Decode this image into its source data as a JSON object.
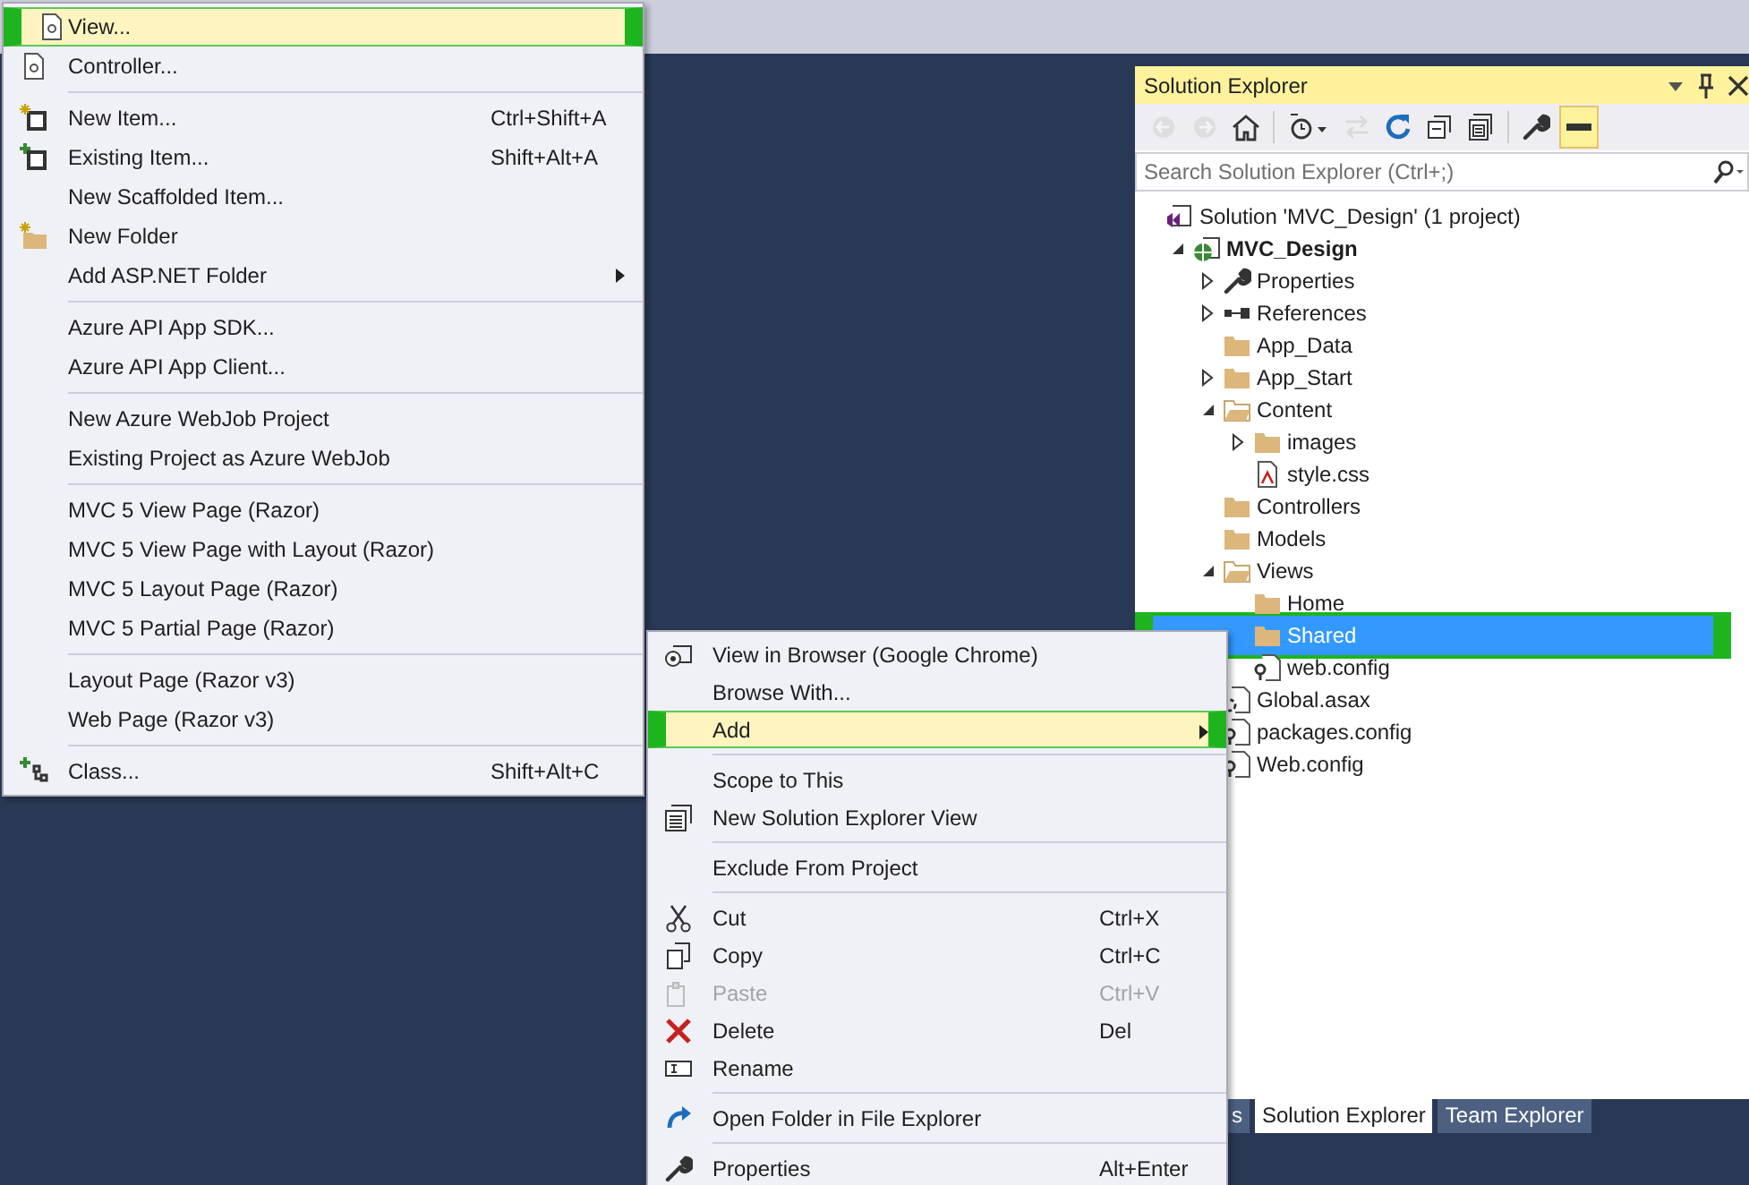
{
  "add_menu": {
    "groups": [
      {
        "items": [
          {
            "label": "View...",
            "kind": "page",
            "selected": true
          },
          {
            "label": "Controller...",
            "kind": "page",
            "selected": false
          }
        ]
      },
      {
        "items": [
          {
            "label": "New Item...",
            "kind": "new-item",
            "shortcut": "Ctrl+Shift+A",
            "selected": false
          },
          {
            "label": "Existing Item...",
            "kind": "existing-item",
            "shortcut": "Shift+Alt+A",
            "selected": false
          },
          {
            "label": "New Scaffolded Item...",
            "kind": "plain",
            "selected": false
          },
          {
            "label": "New Folder",
            "kind": "new-folder",
            "selected": false
          },
          {
            "label": "Add ASP.NET Folder",
            "kind": "plain",
            "submenu": true,
            "selected": false
          }
        ]
      },
      {
        "items": [
          {
            "label": "Azure API App SDK...",
            "kind": "plain",
            "selected": false
          },
          {
            "label": "Azure API App Client...",
            "kind": "plain",
            "selected": false
          }
        ]
      },
      {
        "items": [
          {
            "label": "New Azure WebJob Project",
            "kind": "plain",
            "selected": false
          },
          {
            "label": "Existing Project as Azure WebJob",
            "kind": "plain",
            "selected": false
          }
        ]
      },
      {
        "items": [
          {
            "label": "MVC 5 View Page (Razor)",
            "kind": "plain",
            "selected": false
          },
          {
            "label": "MVC 5 View Page with Layout (Razor)",
            "kind": "plain",
            "selected": false
          },
          {
            "label": "MVC 5 Layout Page (Razor)",
            "kind": "plain",
            "selected": false
          },
          {
            "label": "MVC 5 Partial Page (Razor)",
            "kind": "plain",
            "selected": false
          }
        ]
      },
      {
        "items": [
          {
            "label": "Layout Page (Razor v3)",
            "kind": "plain",
            "selected": false
          },
          {
            "label": "Web Page (Razor v3)",
            "kind": "plain",
            "selected": false
          }
        ]
      },
      {
        "items": [
          {
            "label": "Class...",
            "kind": "class",
            "shortcut": "Shift+Alt+C",
            "selected": false
          }
        ]
      }
    ]
  },
  "solution_explorer": {
    "title": "Solution Explorer",
    "toolbar": [
      {
        "kind": "back",
        "disabled": true,
        "on": false
      },
      {
        "kind": "forward",
        "disabled": true,
        "on": false
      },
      {
        "kind": "home",
        "disabled": false,
        "on": false
      },
      {
        "kind": "history",
        "disabled": false,
        "on": false
      },
      {
        "kind": "sync",
        "disabled": true,
        "on": false
      },
      {
        "kind": "refresh",
        "disabled": false,
        "on": false
      },
      {
        "kind": "collapse",
        "disabled": false,
        "on": false
      },
      {
        "kind": "show-files",
        "disabled": false,
        "on": false
      },
      {
        "kind": "properties",
        "disabled": false,
        "on": false
      },
      {
        "kind": "preview",
        "disabled": false,
        "on": true
      }
    ],
    "search": {
      "placeholder": "Search Solution Explorer (Ctrl+;)"
    },
    "tree": [
      {
        "label": "Solution 'MVC_Design' (1 project)",
        "kind": "solution",
        "selected": false,
        "children": [
          {
            "label": "MVC_Design",
            "kind": "project",
            "expanded": true,
            "selected": false,
            "children": [
              {
                "label": "Properties",
                "kind": "properties",
                "expanded": false,
                "selected": false
              },
              {
                "label": "References",
                "kind": "references",
                "expanded": false,
                "selected": false
              },
              {
                "label": "App_Data",
                "kind": "folder",
                "selected": false
              },
              {
                "label": "App_Start",
                "kind": "folder",
                "expanded": false,
                "selected": false
              },
              {
                "label": "Content",
                "kind": "folder",
                "expanded": true,
                "selected": false,
                "children": [
                  {
                    "label": "images",
                    "kind": "folder",
                    "expanded": false,
                    "selected": false
                  },
                  {
                    "label": "style.css",
                    "kind": "stylesheet",
                    "selected": false
                  }
                ]
              },
              {
                "label": "Controllers",
                "kind": "folder",
                "selected": false
              },
              {
                "label": "Models",
                "kind": "folder",
                "selected": false
              },
              {
                "label": "Views",
                "kind": "folder",
                "expanded": true,
                "selected": false,
                "children": [
                  {
                    "label": "Home",
                    "kind": "folder",
                    "selected": false
                  },
                  {
                    "label": "Shared",
                    "kind": "folder",
                    "selected": true
                  },
                  {
                    "label": "web.config",
                    "kind": "config",
                    "selected": false
                  }
                ]
              },
              {
                "label": "Global.asax",
                "kind": "asax",
                "selected": false
              },
              {
                "label": "packages.config",
                "kind": "config",
                "selected": false
              },
              {
                "label": "Web.config",
                "kind": "config",
                "selected": false
              }
            ]
          }
        ]
      }
    ]
  },
  "tabs": [
    {
      "label": "s",
      "selected": false
    },
    {
      "label": "Solution Explorer",
      "selected": true
    },
    {
      "label": "Team Explorer",
      "selected": false
    }
  ],
  "folder_menu": {
    "groups": [
      {
        "items": [
          {
            "label": "View in Browser (Google Chrome)",
            "kind": "browser",
            "selected": false,
            "disabled": false
          },
          {
            "label": "Browse With...",
            "kind": "plain",
            "selected": false,
            "disabled": false
          },
          {
            "label": "Add",
            "kind": "plain",
            "submenu": true,
            "selected": true,
            "disabled": false
          }
        ]
      },
      {
        "items": [
          {
            "label": "Scope to This",
            "kind": "plain",
            "selected": false,
            "disabled": false
          },
          {
            "label": "New Solution Explorer View",
            "kind": "new-view",
            "selected": false,
            "disabled": false
          }
        ]
      },
      {
        "items": [
          {
            "label": "Exclude From Project",
            "kind": "plain",
            "selected": false,
            "disabled": false
          }
        ]
      },
      {
        "items": [
          {
            "label": "Cut",
            "kind": "cut",
            "shortcut": "Ctrl+X",
            "selected": false,
            "disabled": false
          },
          {
            "label": "Copy",
            "kind": "copy",
            "shortcut": "Ctrl+C",
            "selected": false,
            "disabled": false
          },
          {
            "label": "Paste",
            "kind": "paste",
            "shortcut": "Ctrl+V",
            "selected": false,
            "disabled": true
          },
          {
            "label": "Delete",
            "kind": "delete",
            "shortcut": "Del",
            "selected": false,
            "disabled": false
          },
          {
            "label": "Rename",
            "kind": "rename",
            "selected": false,
            "disabled": false
          }
        ]
      },
      {
        "items": [
          {
            "label": "Open Folder in File Explorer",
            "kind": "open-folder",
            "selected": false,
            "disabled": false
          }
        ]
      },
      {
        "items": [
          {
            "label": "Properties",
            "kind": "properties",
            "shortcut": "Alt+Enter",
            "selected": false,
            "disabled": false
          }
        ]
      }
    ]
  }
}
